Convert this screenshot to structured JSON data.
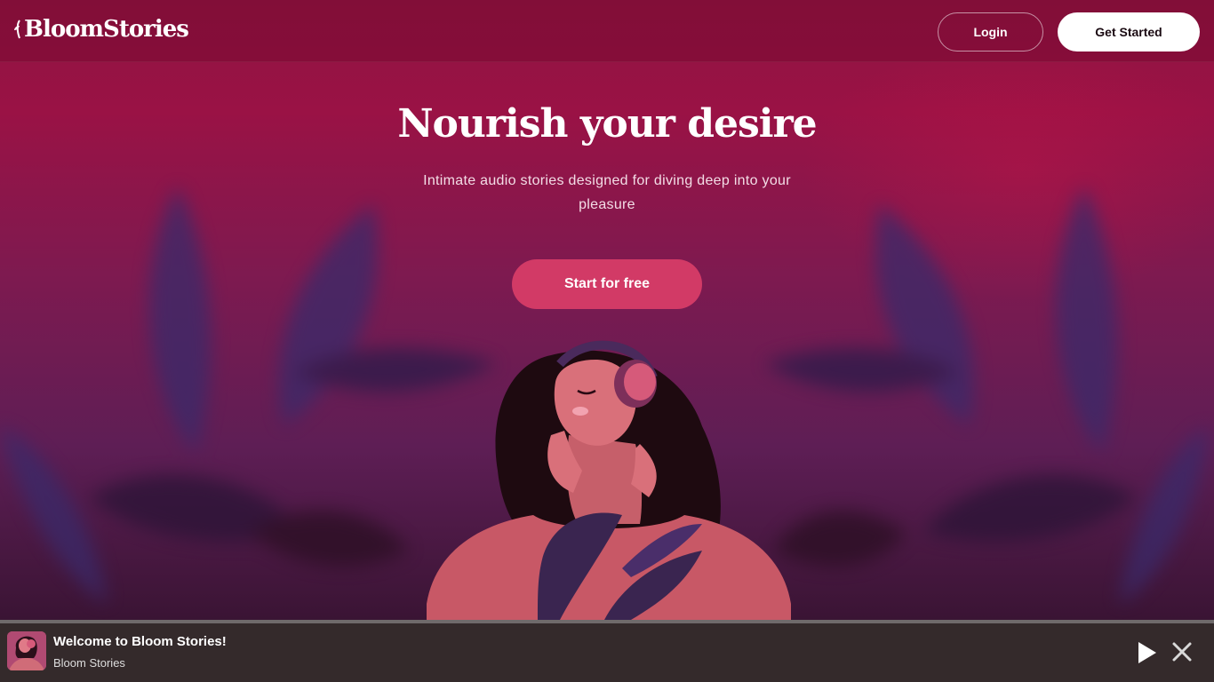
{
  "header": {
    "logo_text": "BloomStories",
    "login_label": "Login",
    "get_started_label": "Get Started"
  },
  "hero": {
    "title": "Nourish your desire",
    "subtitle": "Intimate audio stories designed for diving deep into your pleasure",
    "cta_label": "Start for free"
  },
  "player": {
    "track_title": "Welcome to Bloom Stories!",
    "artist": "Bloom Stories",
    "play_icon": "play-icon",
    "close_icon": "close-icon"
  },
  "colors": {
    "background": "#8f1442",
    "cta": "#d23a66",
    "player_bar": "#342a2b",
    "text_light": "#ffffff"
  }
}
